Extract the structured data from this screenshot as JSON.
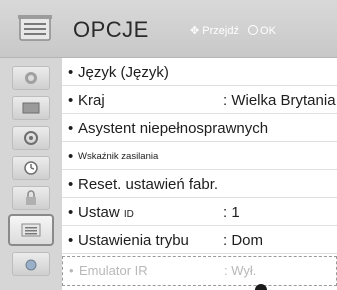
{
  "header": {
    "title": "OPCJE",
    "hint_move": "Przejdź",
    "hint_ok": "OK"
  },
  "sidebar": {
    "items": [
      {
        "icon": "picture-icon"
      },
      {
        "icon": "screen-icon"
      },
      {
        "icon": "audio-icon"
      },
      {
        "icon": "clock-icon"
      },
      {
        "icon": "lock-icon"
      },
      {
        "icon": "options-icon",
        "selected": true
      },
      {
        "icon": "network-icon"
      }
    ]
  },
  "menu": {
    "items": [
      {
        "label": "Język (Język)",
        "value": ""
      },
      {
        "label": "Kraj",
        "value": ": Wielka Brytania"
      },
      {
        "label": "Asystent niepełnosprawnych",
        "value": ""
      },
      {
        "label": "Wskaźnik zasilania",
        "value": ""
      },
      {
        "label": "Reset. ustawień fabr.",
        "value": ""
      },
      {
        "label": "Ustaw",
        "label_suffix": "ID",
        "value": ": 1"
      },
      {
        "label": "Ustawienia trybu",
        "value": ": Dom"
      },
      {
        "label": "Emulator IR",
        "value": ": Wył."
      }
    ]
  },
  "colors": {
    "header_bg": "#cfcfcf",
    "sidebar_bg": "#d6d6d6",
    "text": "#1e1e1e",
    "disabled_text": "#b8b8b8"
  }
}
